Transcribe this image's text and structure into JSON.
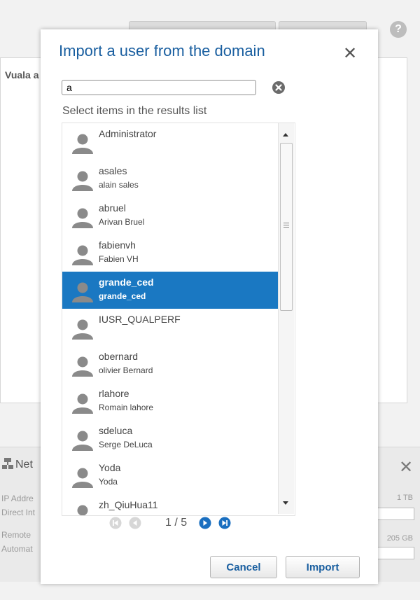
{
  "background": {
    "panel_title": "Vuala a",
    "network_title": "Net",
    "labels": [
      "IP Addre",
      "Direct Int",
      "Remote",
      "Automat"
    ],
    "capacity_1": "1 TB",
    "capacity_2": "205 GB"
  },
  "dialog": {
    "title": "Import a user from the domain",
    "search": {
      "value": "a",
      "placeholder": ""
    },
    "instructions": "Select items in the results list",
    "results": [
      {
        "name": "Administrator",
        "subtitle": ""
      },
      {
        "name": "asales",
        "subtitle": "alain sales"
      },
      {
        "name": "abruel",
        "subtitle": "Arivan Bruel"
      },
      {
        "name": "fabienvh",
        "subtitle": "Fabien VH"
      },
      {
        "name": "grande_ced",
        "subtitle": "grande_ced",
        "selected": true
      },
      {
        "name": "IUSR_QUALPERF",
        "subtitle": ""
      },
      {
        "name": "obernard",
        "subtitle": "olivier Bernard"
      },
      {
        "name": "rlahore",
        "subtitle": "Romain lahore"
      },
      {
        "name": "sdeluca",
        "subtitle": "Serge DeLuca"
      },
      {
        "name": "Yoda",
        "subtitle": "Yoda"
      },
      {
        "name": "zh_QiuHua11",
        "subtitle": ""
      }
    ],
    "pagination": {
      "text": "1 / 5"
    },
    "cancel_label": "Cancel",
    "import_label": "Import"
  },
  "colors": {
    "accent": "#1a5fa0",
    "selection": "#1a78c2"
  }
}
